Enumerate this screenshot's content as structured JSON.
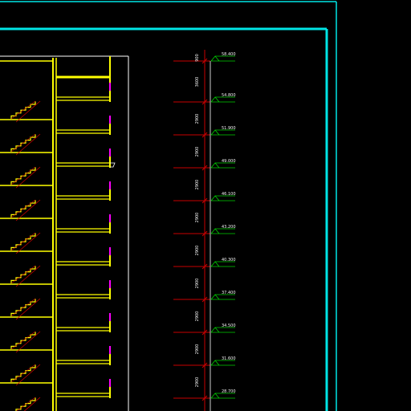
{
  "colors": {
    "background": "#000000",
    "frame": "#00e5e5",
    "wall": "#ffff00",
    "dimension": "#c80000",
    "level_symbol": "#00d000",
    "window": "#ff00ff",
    "outline": "#ffffff",
    "text": "#f2f2f2"
  },
  "elevation_levels": [
    "58.400",
    "54.800",
    "51.900",
    "49.000",
    "46.100",
    "43.200",
    "40.300",
    "37.400",
    "34.500",
    "31.600",
    "28.700"
  ],
  "dimension_labels": [
    "900",
    "3600",
    "2900",
    "2900",
    "2900",
    "2900",
    "2900",
    "2900",
    "2900",
    "2900",
    "2900"
  ]
}
